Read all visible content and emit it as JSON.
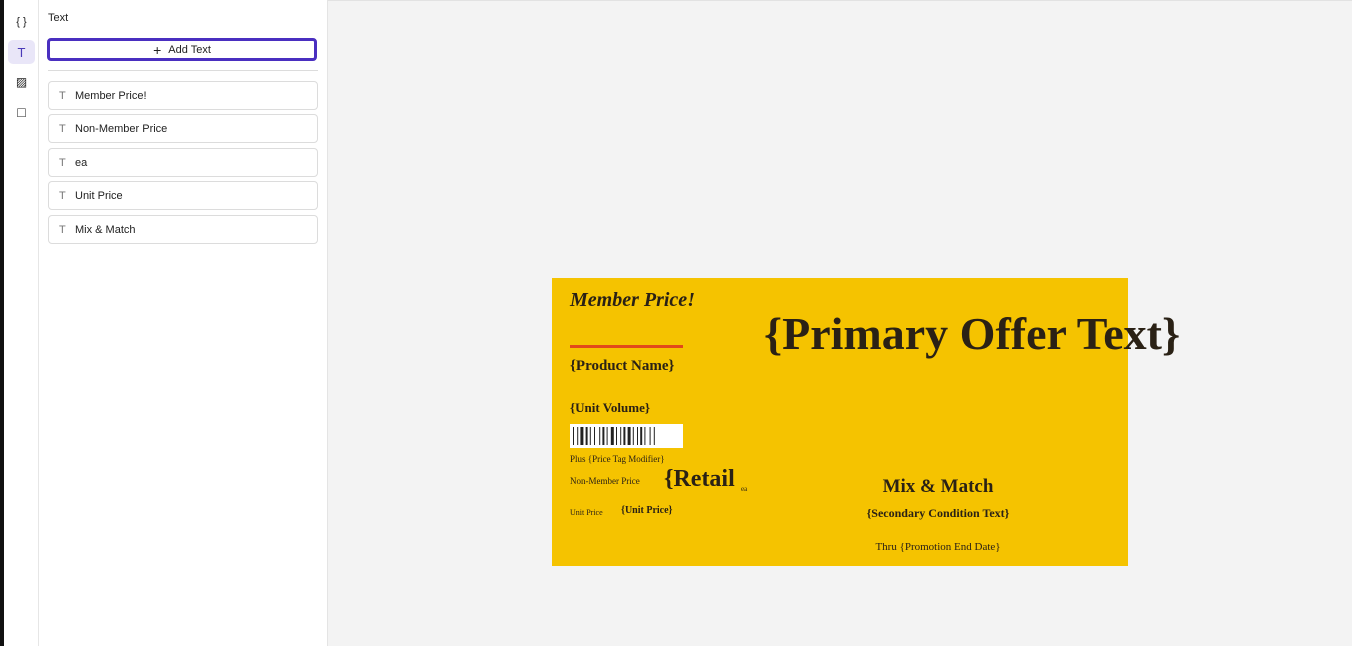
{
  "rail": {
    "items": [
      {
        "name": "variables",
        "glyph": "{ }"
      },
      {
        "name": "text",
        "glyph": "T"
      },
      {
        "name": "image",
        "glyph": "▨"
      },
      {
        "name": "shape",
        "glyph": "□"
      }
    ],
    "active": "text"
  },
  "panel": {
    "title": "Text",
    "add_label": "Add Text",
    "add_icon": "+",
    "layer_icon": "T",
    "layers": [
      "Member Price!",
      "Non-Member Price",
      "ea",
      "Unit Price",
      "Mix & Match"
    ]
  },
  "tag": {
    "background": "#f5c300",
    "accent_line": "#e2481a",
    "member_price": "Member Price!",
    "product_name": "{Product Name}",
    "unit_volume": "{Unit Volume}",
    "price_modifier": "Plus {Price Tag Modifier}",
    "non_member_label": "Non-Member Price",
    "retail": "{Retail",
    "ea": "ea",
    "unit_price_label": "Unit Price",
    "unit_price": "{Unit Price}",
    "primary_offer": "{Primary Offer Text}",
    "mix_match": "Mix & Match",
    "secondary_condition": "{Secondary Condition Text}",
    "promotion_end": "Thru {Promotion End Date}"
  }
}
